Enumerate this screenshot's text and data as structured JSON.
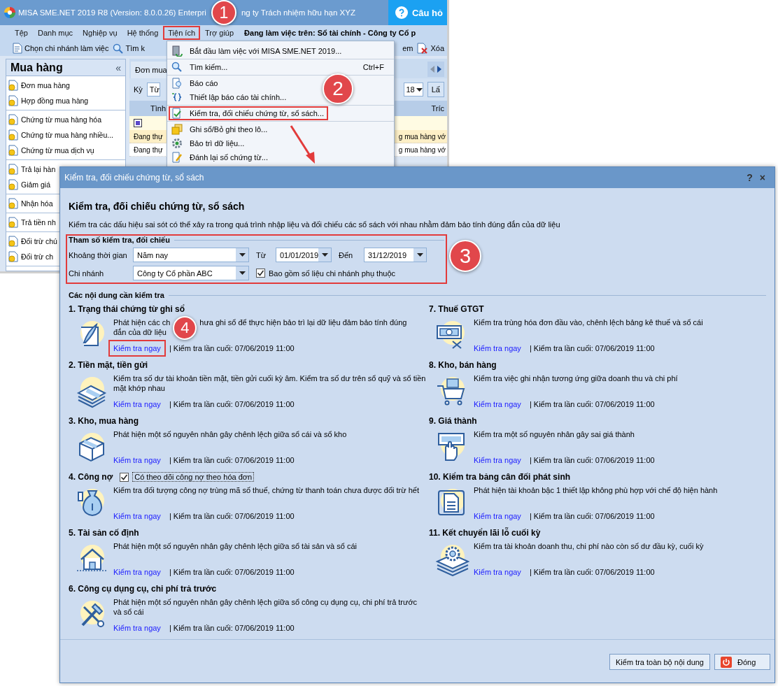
{
  "app_window": {
    "title_parts": [
      "MISA SME.NET 2019 R8 (Version: 8.0.0.26) Enterpri",
      "ng ty Trách nhiệm hữu hạn XYZ"
    ],
    "help_button": "Câu hỏ",
    "menu": [
      {
        "label": "Tệp",
        "highlighted": false
      },
      {
        "label": "Danh mục",
        "highlighted": false
      },
      {
        "label": "Nghiệp vụ",
        "highlighted": false
      },
      {
        "label": "Hệ thống",
        "highlighted": false
      },
      {
        "label": "Tiện ích",
        "highlighted": true
      },
      {
        "label": "Trợ giúp",
        "highlighted": false
      }
    ],
    "working_on": "Đang làm việc trên: Sổ tài chính - Công ty Cổ p",
    "toolbar": [
      "Chọn chi nhánh làm việc",
      "Tìm k",
      "em",
      "Xóa"
    ],
    "sidebar": {
      "title": "Mua hàng",
      "collapse": "«",
      "groups": [
        [
          "Đơn mua hàng",
          "Hợp đồng mua hàng"
        ],
        [
          "Chứng từ mua hàng hóa",
          "Chứng từ mua hàng nhiều...",
          "Chứng từ mua dịch vụ"
        ],
        [
          "Trả lại hàn",
          "Giảm giá"
        ],
        [
          "Nhận hóa"
        ],
        [
          "Trả tiền nh"
        ],
        [
          "Đối trừ chú",
          "Đối trừ ch"
        ]
      ]
    },
    "main": {
      "tab": "Đơn mua",
      "period_label": "Kỳ",
      "period_combo": "Từ",
      "year_combo": "18",
      "button": "Lấ",
      "columns": [
        "Tình",
        "Tríc"
      ],
      "rows": [
        {
          "cells": [
            "Đang thự",
            "g mua hàng vớ"
          ],
          "selected": true
        },
        {
          "cells": [
            "Đang thự",
            "g mua hàng vớ"
          ],
          "selected": false
        }
      ]
    }
  },
  "menu_dropdown": {
    "groups": [
      [
        {
          "label": "Bắt đầu làm việc với MISA SME.NET 2019...",
          "highlighted": false
        }
      ],
      [
        {
          "label": "Tìm kiếm...",
          "shortcut": "Ctrl+F",
          "highlighted": false
        }
      ],
      [
        {
          "label": "Báo cáo",
          "highlighted": false
        },
        {
          "label": "Thiết lập báo cáo tài chính...",
          "highlighted": false
        }
      ],
      [
        {
          "label": "Kiểm tra, đối chiếu chứng từ, sổ sách...",
          "highlighted": true
        }
      ],
      [
        {
          "label": "Ghi sổ/Bỏ ghi theo lô...",
          "highlighted": false
        },
        {
          "label": "Bảo trì dữ liệu...",
          "highlighted": false
        },
        {
          "label": "Đánh lại số chứng từ...",
          "highlighted": false
        }
      ]
    ]
  },
  "dialog": {
    "title": "Kiểm tra, đối chiếu chứng từ, sổ sách",
    "help": "?",
    "close": "×",
    "heading": "Kiểm tra, đối chiếu chứng từ, sổ sách",
    "description": "Kiểm tra các dấu hiệu sai sót có thể xảy ra trong quá trình nhập liệu và đối chiếu các sổ sách với nhau nhằm đảm bảo tính đúng đắn của dữ liệu",
    "parameters": {
      "title": "Tham số kiểm tra, đối chiếu",
      "highlighted": true,
      "period_label": "Khoảng thời gian",
      "period": "Năm nay",
      "from_label": "Từ",
      "from": "01/01/2019",
      "to_label": "Đến",
      "to": "31/12/2019",
      "branch_label": "Chi nhánh",
      "branch": "Công ty Cổ phần ABC",
      "include_dependent": {
        "label": "Bao gồm số liệu chi nhánh phụ thuộc",
        "checked": true
      }
    },
    "checks_title": "Các nội dung cần kiểm tra",
    "columns": [
      [
        {
          "title": "1. Trạng thái chứng từ ghi sổ",
          "description": [
            [
              "Phát hiện các ch",
              "hưa ghi sổ để thực hiện bảo trì lại dữ liệu đảm bảo tính đúng"
            ],
            [
              "đắn của dữ liệu"
            ]
          ],
          "link": "Kiểm tra ngay",
          "link_highlighted": true,
          "last_check": "| Kiểm tra lần cuối: 07/06/2019 11:00"
        },
        {
          "title": "2. Tiền mặt, tiền gửi",
          "description": "Kiểm tra số dư tài khoản tiền mặt, tiền gửi cuối kỳ âm. Kiểm tra số dư trên sổ quỹ và sổ tiền mặt khớp nhau",
          "link": "Kiểm tra ngay",
          "link_highlighted": false,
          "last_check": "| Kiểm tra lần cuối: 07/06/2019 11:00"
        },
        {
          "title": "3. Kho, mua hàng",
          "description": "Phát hiện một số nguyên nhân gây chênh lệch giữa sổ cái và sổ kho",
          "link": "Kiểm tra ngay",
          "link_highlighted": false,
          "last_check": "| Kiểm tra lần cuối: 07/06/2019 11:00"
        },
        {
          "title": "4. Công nợ",
          "option": {
            "label": "Có theo dõi công nợ theo hóa đơn",
            "checked": true
          },
          "description": "Kiểm tra đối tượng công nợ trùng mã số thuế, chứng từ thanh toán chưa được đối trừ hết",
          "link": "Kiểm tra ngay",
          "link_highlighted": false,
          "last_check": "| Kiểm tra lần cuối: 07/06/2019 11:00"
        },
        {
          "title": "5. Tài sản cố định",
          "description": "Phát hiện một số nguyên nhân gây chênh lệch giữa sổ tài sản và sổ cái",
          "link": "Kiểm tra ngay",
          "link_highlighted": false,
          "last_check": "| Kiểm tra lần cuối: 07/06/2019 11:00"
        },
        {
          "title": "6. Công cụ dụng cụ, chi phí trả trước",
          "description": "Phát hiện một số nguyên nhân gây chênh lệch giữa sổ công cụ dụng cụ, chi phí trả trước và sổ cái",
          "link": "Kiểm tra ngay",
          "link_highlighted": false,
          "last_check": "| Kiểm tra lần cuối: 07/06/2019 11:00"
        }
      ],
      [
        {
          "title": "7. Thuế GTGT",
          "description": "Kiểm tra trùng hóa đơn đầu vào, chênh lệch bảng kê thuế và sổ cái",
          "link": "Kiểm tra ngay",
          "link_highlighted": false,
          "last_check": "| Kiểm tra lần cuối: 07/06/2019 11:00"
        },
        {
          "title": "8. Kho, bán hàng",
          "description": "Kiểm tra việc ghi nhận tương ứng giữa doanh thu và chi phí",
          "link": "Kiểm tra ngay",
          "link_highlighted": false,
          "last_check": "| Kiểm tra lần cuối: 07/06/2019 11:00"
        },
        {
          "title": "9. Giá thành",
          "description": "Kiểm tra một số nguyên nhân gây sai giá thành",
          "link": "Kiểm tra ngay",
          "link_highlighted": false,
          "last_check": "| Kiểm tra lần cuối: 07/06/2019 11:00"
        },
        {
          "title": "10. Kiểm tra bảng cân đối phát sinh",
          "description": "Phát hiện tài khoản bậc 1 thiết lập không phù hợp với chế độ hiện hành",
          "link": "Kiểm tra ngay",
          "link_highlighted": false,
          "last_check": "| Kiểm tra lần cuối: 07/06/2019 11:00"
        },
        {
          "title": "11. Kết chuyển lãi lỗ cuối kỳ",
          "description": "Kiểm tra tài khoản doanh thu, chi phí nào còn số dư đầu kỳ, cuối kỳ",
          "link": "Kiểm tra ngay",
          "link_highlighted": false,
          "last_check": "| Kiểm tra lần cuối: 07/06/2019 11:00"
        }
      ]
    ],
    "buttons": [
      {
        "label": "Kiểm tra toàn bộ nội dung",
        "kind": "plain"
      },
      {
        "label": "Đóng",
        "kind": "close"
      }
    ]
  },
  "callouts": [
    "1",
    "2",
    "3",
    "4"
  ]
}
